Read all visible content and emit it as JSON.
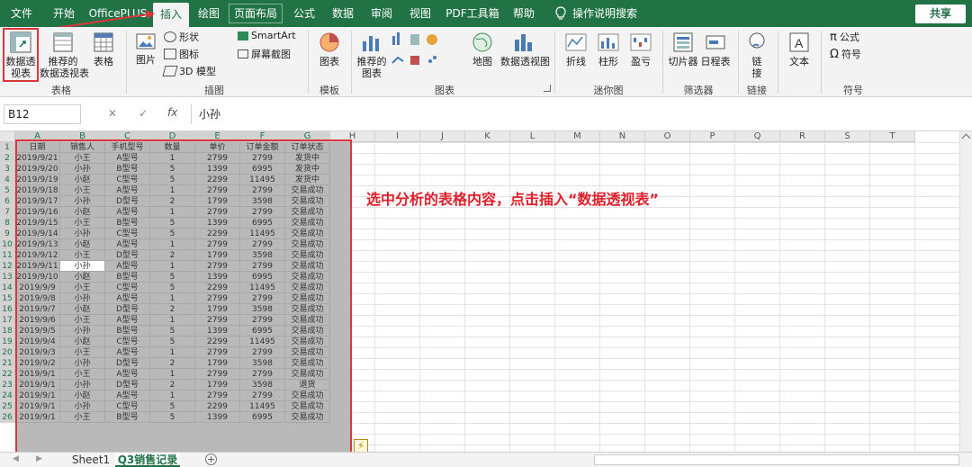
{
  "menu": {
    "tabs": [
      "文件",
      "开始",
      "OfficePLUS",
      "插入",
      "绘图",
      "页面布局",
      "公式",
      "数据",
      "审阅",
      "视图",
      "PDF工具箱",
      "帮助"
    ],
    "active": "插入",
    "tell_me": "操作说明搜索",
    "share": "共享"
  },
  "ribbon": {
    "tables": {
      "pivot": "数据透\n视表",
      "recommended_pivot": "推荐的\n数据透视表",
      "table": "表格",
      "group": "表格"
    },
    "illustrations": {
      "pictures": "图片",
      "shapes": "形状",
      "icons": "图标",
      "models3d": "3D 模型",
      "smartart": "SmartArt",
      "screenshot": "屏幕截图",
      "group": "插图"
    },
    "templates": {
      "chart": "图表",
      "group": "模板"
    },
    "charts": {
      "recommended": "推荐的\n图表",
      "map": "地图",
      "pivot_chart": "数据透视图",
      "group": "图表"
    },
    "sparklines": {
      "line": "折线",
      "column": "柱形",
      "winloss": "盈亏",
      "group": "迷你图"
    },
    "filters": {
      "slicer": "切片器",
      "timeline": "日程表",
      "group": "筛选器"
    },
    "links": {
      "link": "链\n接",
      "group": "链接"
    },
    "text": {
      "text": "文本"
    },
    "symbols": {
      "equation": "公式",
      "symbol": "符号",
      "group": "符号"
    }
  },
  "formula_bar": {
    "name_box": "B12",
    "fx": "fx",
    "value": "小孙"
  },
  "columns": [
    "A",
    "B",
    "C",
    "D",
    "E",
    "F",
    "G",
    "H",
    "I",
    "J",
    "K",
    "L",
    "M",
    "N",
    "O",
    "P",
    "Q",
    "R",
    "S",
    "T"
  ],
  "rows": [
    "1",
    "2",
    "3",
    "4",
    "5",
    "6",
    "7",
    "8",
    "9",
    "10",
    "11",
    "12",
    "13",
    "14",
    "15",
    "16",
    "17",
    "18",
    "19",
    "20",
    "21",
    "22",
    "23",
    "24",
    "25",
    "26"
  ],
  "table": {
    "headers": [
      "日期",
      "销售人",
      "手机型号",
      "数量",
      "单价",
      "订单金额",
      "订单状态"
    ],
    "rows": [
      [
        "2019/9/21",
        "小王",
        "A型号",
        "1",
        "2799",
        "2799",
        "发货中"
      ],
      [
        "2019/9/20",
        "小孙",
        "B型号",
        "5",
        "1399",
        "6995",
        "发货中"
      ],
      [
        "2019/9/19",
        "小赵",
        "C型号",
        "5",
        "2299",
        "11495",
        "发货中"
      ],
      [
        "2019/9/18",
        "小王",
        "A型号",
        "1",
        "2799",
        "2799",
        "交易成功"
      ],
      [
        "2019/9/17",
        "小孙",
        "D型号",
        "2",
        "1799",
        "3598",
        "交易成功"
      ],
      [
        "2019/9/16",
        "小赵",
        "A型号",
        "1",
        "2799",
        "2799",
        "交易成功"
      ],
      [
        "2019/9/15",
        "小王",
        "B型号",
        "5",
        "1399",
        "6995",
        "交易成功"
      ],
      [
        "2019/9/14",
        "小孙",
        "C型号",
        "5",
        "2299",
        "11495",
        "交易成功"
      ],
      [
        "2019/9/13",
        "小赵",
        "A型号",
        "1",
        "2799",
        "2799",
        "交易成功"
      ],
      [
        "2019/9/12",
        "小王",
        "D型号",
        "2",
        "1799",
        "3598",
        "交易成功"
      ],
      [
        "2019/9/11",
        "小孙",
        "A型号",
        "1",
        "2799",
        "2799",
        "交易成功"
      ],
      [
        "2019/9/10",
        "小赵",
        "B型号",
        "5",
        "1399",
        "6995",
        "交易成功"
      ],
      [
        "2019/9/9",
        "小王",
        "C型号",
        "5",
        "2299",
        "11495",
        "交易成功"
      ],
      [
        "2019/9/8",
        "小孙",
        "A型号",
        "1",
        "2799",
        "2799",
        "交易成功"
      ],
      [
        "2019/9/7",
        "小赵",
        "D型号",
        "2",
        "1799",
        "3598",
        "交易成功"
      ],
      [
        "2019/9/6",
        "小王",
        "A型号",
        "1",
        "2799",
        "2799",
        "交易成功"
      ],
      [
        "2019/9/5",
        "小孙",
        "B型号",
        "5",
        "1399",
        "6995",
        "交易成功"
      ],
      [
        "2019/9/4",
        "小赵",
        "C型号",
        "5",
        "2299",
        "11495",
        "交易成功"
      ],
      [
        "2019/9/3",
        "小王",
        "A型号",
        "1",
        "2799",
        "2799",
        "交易成功"
      ],
      [
        "2019/9/2",
        "小孙",
        "D型号",
        "2",
        "1799",
        "3598",
        "交易成功"
      ],
      [
        "2019/9/1",
        "小王",
        "A型号",
        "1",
        "2799",
        "2799",
        "交易成功"
      ],
      [
        "2019/9/1",
        "小孙",
        "D型号",
        "2",
        "1799",
        "3598",
        "退货"
      ],
      [
        "2019/9/1",
        "小赵",
        "A型号",
        "1",
        "2799",
        "2799",
        "交易成功"
      ],
      [
        "2019/9/1",
        "小孙",
        "C型号",
        "5",
        "2299",
        "11495",
        "交易成功"
      ],
      [
        "2019/9/1",
        "小王",
        "B型号",
        "5",
        "1399",
        "6995",
        "交易成功"
      ]
    ]
  },
  "active_cell": {
    "row": 11,
    "col": 1
  },
  "annotation": "选中分析的表格内容，点击插入“数据透视表”",
  "sheets": [
    "Sheet1",
    "Q3销售记录"
  ],
  "active_sheet": 1,
  "colors": {
    "excel_green": "#217346",
    "highlight_red": "#d9363e"
  }
}
